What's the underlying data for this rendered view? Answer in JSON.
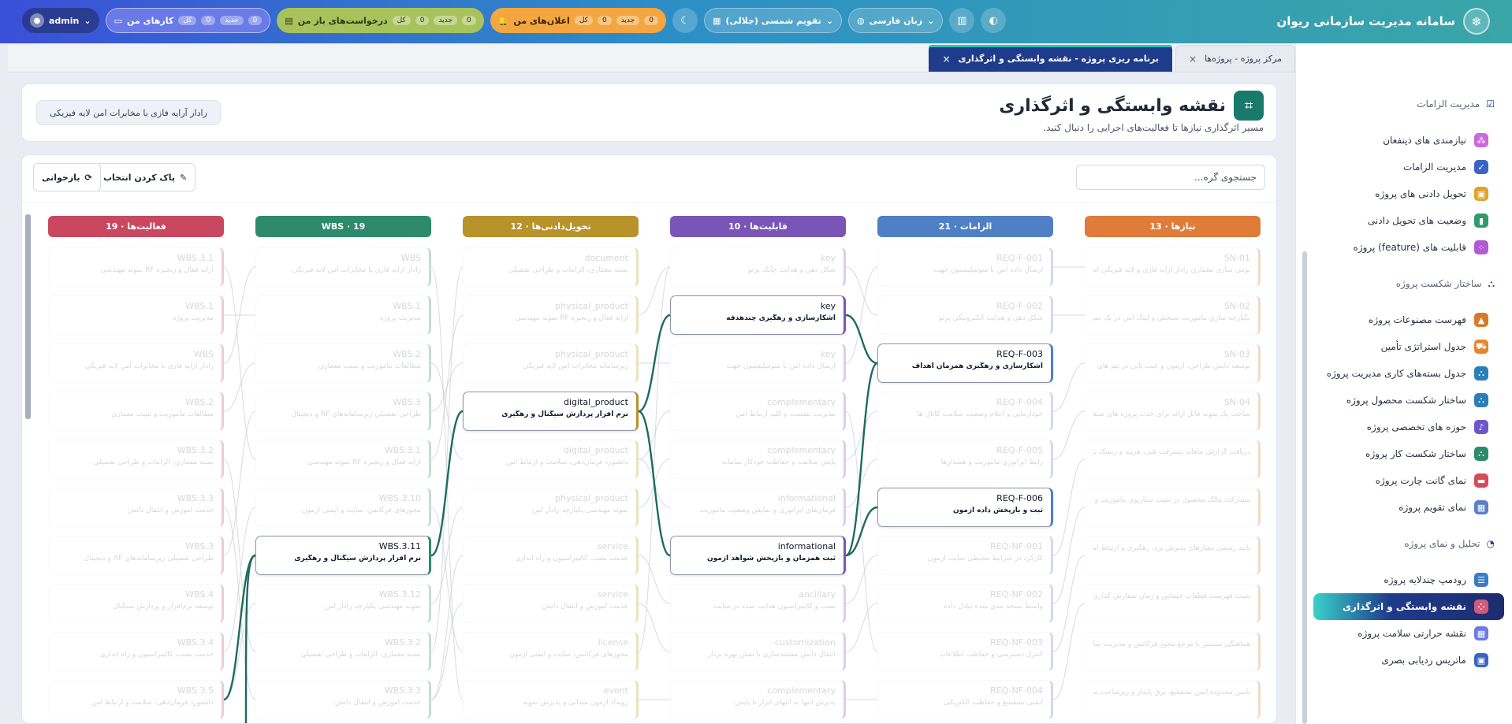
{
  "app": {
    "title": "سامانه مدیریت سازمانی ریوان"
  },
  "topbar": {
    "admin": "admin",
    "work": {
      "label": "کارهای من",
      "all": "کل",
      "new": "جدید",
      "c1": "0",
      "c2": "0"
    },
    "requests": {
      "label": "درخواست‌های باز من",
      "all": "کل",
      "new": "جدید",
      "c1": "0",
      "c2": "0"
    },
    "notifications": {
      "label": "اعلان‌های من",
      "all": "کل",
      "new": "جدید",
      "c1": "0",
      "c2": "0"
    },
    "calendar": "تقویم  شمسی (جلالی)",
    "language": "زبان  فارسی"
  },
  "tabs": [
    {
      "label": "مرکز پروژه  -  پروژه‌ها"
    },
    {
      "label": "برنامه ریزی پروژه  -  نقشه وابستگی و اثرگذاری"
    }
  ],
  "sidebar": {
    "sec1": "مدیریت الزامات",
    "sec1_items": [
      "نیازمندی های ذینفعان",
      "مدیریت الزامات",
      "تحویل دادنی های پروژه",
      "وضعیت های تحویل دادنی",
      "قابلیت های (feature) پروژه"
    ],
    "sec2": "ساختار شکست پروژه",
    "sec2_items": [
      "فهرست مصنوعات پروژه",
      "جدول استراتژی تأمین",
      "جدول بسته‌های کاری مدیریت پروژه",
      "ساختار شکست محصول پروژه",
      "حوزه های تخصصی پروژه",
      "ساختار شکست کار پروژه",
      "نمای گانت چارت پروژه",
      "نمای تقویم پروژه"
    ],
    "sec3": "تحلیل و نمای پروژه",
    "sec3_items": [
      "رودمپ چندلایه پروژه",
      "نقشه وابستگی و اثرگذاری",
      "نقشه حرارتی سلامت پروژه",
      "ماتریس ردیابی بصری"
    ]
  },
  "header": {
    "title": "نقشه وابستگی و اثرگذاری",
    "subtitle": "مسیر اثرگذاری نیازها تا فعالیت‌های اجرایی را دنبال کنید.",
    "badge": "رادار آرایه فازی با مخابرات امن لایه فیزیکی"
  },
  "toolbar": {
    "search_placeholder": "جستجوی گره...",
    "clear": "پاک کردن انتخاب",
    "reload": "بازخوانی"
  },
  "colors": {
    "needs": "#e07b39",
    "reqs": "#4f7fc4",
    "caps": "#7a55b8",
    "deliv": "#b8922a",
    "wbs": "#2d8a6a",
    "acts": "#c9485f",
    "link": "#1f6b5c"
  },
  "columns": [
    {
      "key": "needs",
      "title": "نیازها · 13",
      "nodes": [
        {
          "t": "SN-01",
          "s": "بومی سازی معماری رادار آرایه فازی و لایه فیزیکی امن."
        },
        {
          "t": "SN-02",
          "s": "یکپارچه سازی ماموریت سنجش و لینک امن در یک نمونه"
        },
        {
          "t": "SN-03",
          "s": "توسعه دانش طراحی، آزمون و عیب یابی در تیم های"
        },
        {
          "t": "SN-04",
          "s": "ساخت یک نمونه قابل ارائه برای جذب پروژه های صنعتی"
        },
        {
          "t": "",
          "s": "دریافت گزارش ماهانه پیشرفت فنی، هزینه و ریسک توسط"
        },
        {
          "t": "",
          "s": "مشارکت مالک محصول در تثبیت سناریوی ماموریت و خط"
        },
        {
          "t": "",
          "s": "تایید رسمی معیارهای پذیرش برد، رهگیری و ارتباط امن"
        },
        {
          "t": "",
          "s": "تثبیت فهرست قطعات حساس و زمان سفارش گذاری اقلام"
        },
        {
          "t": "",
          "s": "هماهنگی مستمر با مرجع مجوز فرکانس و مدیریت سایت"
        },
        {
          "t": "",
          "s": "تامین محدوده ایمن تشعشع، برق پایدار و زیرساخت سایت"
        }
      ]
    },
    {
      "key": "reqs",
      "title": "الزامات · 21",
      "nodes": [
        {
          "t": "REQ-F-001",
          "s": "ارسال داده امن با متوسلیسیون جهت"
        },
        {
          "t": "REQ-F-002",
          "s": "شکل دهی و هدایت الکترونیکی پرتو"
        },
        {
          "t": "REQ-F-003",
          "s": "آشکارسازی و رهگیری همزمان اهداف",
          "hl": true
        },
        {
          "t": "REQ-F-004",
          "s": "خودآزمایی و اعلام وضعیت سلامت کانال ها"
        },
        {
          "t": "REQ-F-005",
          "s": "رابط اپراتوری ماموریت و هشدارها"
        },
        {
          "t": "REQ-F-006",
          "s": "ثبت و بازپخش داده آزمون",
          "hl": true
        },
        {
          "t": "REQ-NF-001",
          "s": "کارکرد در شرایط محیطی سایت آزمون"
        },
        {
          "t": "REQ-NF-002",
          "s": "واسط نسخه بندی شده تبادل داده"
        },
        {
          "t": "REQ-NF-003",
          "s": "کنترل دسترسی و حفاظت اطلاعات"
        },
        {
          "t": "REQ-NF-004",
          "s": "ایمنی تشعشع و حفاظت الکتریکی"
        }
      ]
    },
    {
      "key": "caps",
      "title": "قابلیت‌ها · 10",
      "nodes": [
        {
          "t": "key",
          "s": "شکل دهی و هدایت چابک پرتو"
        },
        {
          "t": "key",
          "s": "آشکارسازی و رهگیری چندهدفه",
          "hl": true
        },
        {
          "t": "key",
          "s": "ارسال داده امن با متوسلیسیون جهت"
        },
        {
          "t": "complementary",
          "s": "مدیریت نشست و کلید ارتباط امن"
        },
        {
          "t": "complementary",
          "s": "پایش سلامت و حفاظت خودکار سامانه"
        },
        {
          "t": "informational",
          "s": "فرمان‌های اپراتوری و نمایش وضعیت ماموریت"
        },
        {
          "t": "informational",
          "s": "ثبت همزمان و بازپخش شواهد آزمون",
          "hl": true
        },
        {
          "t": "ancillary",
          "s": "نصب و کالیبراسیون هدایت شده در سایت"
        },
        {
          "t": "customization",
          "s": "انتقال دانش مستندسازی با نقش بهره بردار"
        },
        {
          "t": "complementary",
          "s": "پذیرش انتها به انتهای ابزار با پایش"
        }
      ]
    },
    {
      "key": "deliv",
      "title": "تحویل‌دادنی‌ها · 12",
      "nodes": [
        {
          "t": "document",
          "s": "بسته معماری، الزامات و طراحی تفصیلی"
        },
        {
          "t": "physical_product",
          "s": "آرایه فعال و زنجیره RF نمونه مهندسی"
        },
        {
          "t": "physical_product",
          "s": "زیرسامانه مخابرات امن لایه فیزیکی"
        },
        {
          "t": "digital_product",
          "s": "نرم افزار پردازش سیگنال و رهگیری",
          "hl": true
        },
        {
          "t": "digital_product",
          "s": "داشبورد فرمان‌دهی، سلامت و ارتباط امن"
        },
        {
          "t": "physical_product",
          "s": "نمونه مهندسی یکپارچه رادار امن"
        },
        {
          "t": "service",
          "s": "خدمت نصب، کالیبراسیون و راه اندازی"
        },
        {
          "t": "service",
          "s": "خدمت آموزش و انتقال دانش"
        },
        {
          "t": "license",
          "s": "مجوزهای فرکانس، سایت و ایمنی آزمون"
        },
        {
          "t": "event",
          "s": "رویداد آزمون میدانی و پذیرش نمونه"
        }
      ]
    },
    {
      "key": "wbs",
      "title": "WBS · 19",
      "nodes": [
        {
          "t": "WBS",
          "s": "رادار آرایه فازی با مخابرات امن لایه فیزیکی"
        },
        {
          "t": "WBS.1",
          "s": "مدیریت پروژه"
        },
        {
          "t": "WBS.2",
          "s": "مطالعات ماموریت و تثبیت معماری"
        },
        {
          "t": "WBS.3",
          "s": "طراحی تفصیلی زیرسامانه‌های RF و دیجیتال"
        },
        {
          "t": "WBS.3.1",
          "s": "آرایه فعال و زنجیره RF نمونه مهندسی"
        },
        {
          "t": "WBS.3.10",
          "s": "مجوزهای فرکانس، سایت و ایمنی آزمون"
        },
        {
          "t": "WBS.3.11",
          "s": "نرم افزار پردازش سیگنال و رهگیری",
          "hl": true
        },
        {
          "t": "WBS.3.12",
          "s": "نمونه مهندسی یکپارچه رادار امن"
        },
        {
          "t": "WBS.3.2",
          "s": "بسته معماری، الزامات و طراحی تفصیلی"
        },
        {
          "t": "WBS.3.3",
          "s": "خدمت آموزش و انتقال دانش"
        }
      ]
    },
    {
      "key": "acts",
      "title": "فعالیت‌ها · 19",
      "nodes": [
        {
          "t": "WBS.3.1",
          "s": "آرایه فعال و زنجیره RF نمونه مهندسی"
        },
        {
          "t": "WBS.1",
          "s": "مدیریت پروژه"
        },
        {
          "t": "WBS",
          "s": "رادار آرایه فازی با مخابرات امن لایه فیزیکی"
        },
        {
          "t": "WBS.2",
          "s": "مطالعات ماموریت و تثبیت معماری"
        },
        {
          "t": "WBS.3.2",
          "s": "بسته معماری، الزامات و طراحی تفصیلی"
        },
        {
          "t": "WBS.3.3",
          "s": "خدمت آموزش و انتقال دانش"
        },
        {
          "t": "WBS.3",
          "s": "طراحی تفصیلی زیرسامانه‌های RF و دیجیتال"
        },
        {
          "t": "WBS.4",
          "s": "توسعه نرم‌افزار و پردازش سیگنال"
        },
        {
          "t": "WBS.3.4",
          "s": "خدمت نصب، کالیبراسیون و راه اندازی"
        },
        {
          "t": "WBS.3.5",
          "s": "داشبورد فرمان‌دهی، سلامت و ارتباط امن"
        }
      ]
    }
  ]
}
